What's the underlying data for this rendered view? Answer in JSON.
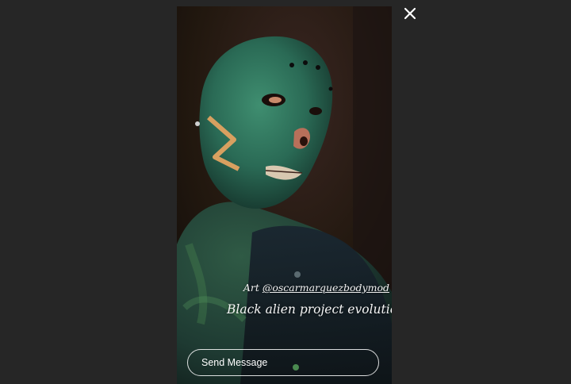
{
  "window": {
    "close_icon": "close-icon"
  },
  "story": {
    "credit_prefix": "Art ",
    "credit_handle": "@oscarmarquezbodymod",
    "caption": "Black alien project evolution"
  },
  "reply": {
    "placeholder": "Send Message"
  },
  "colors": {
    "background": "#262626",
    "reply_border": "#ffffff",
    "text": "#f5f5f5"
  }
}
